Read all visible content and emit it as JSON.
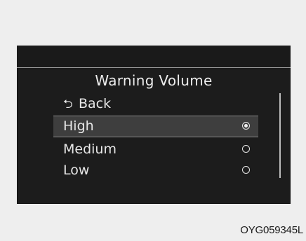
{
  "menu": {
    "title": "Warning Volume",
    "back": {
      "icon": "back-arrow-icon",
      "icon_glyph": "⮌",
      "label": "Back"
    },
    "options": [
      {
        "label": "High",
        "selected": true
      },
      {
        "label": "Medium",
        "selected": false
      },
      {
        "label": "Low",
        "selected": false
      }
    ]
  },
  "caption": "OYG059345L"
}
